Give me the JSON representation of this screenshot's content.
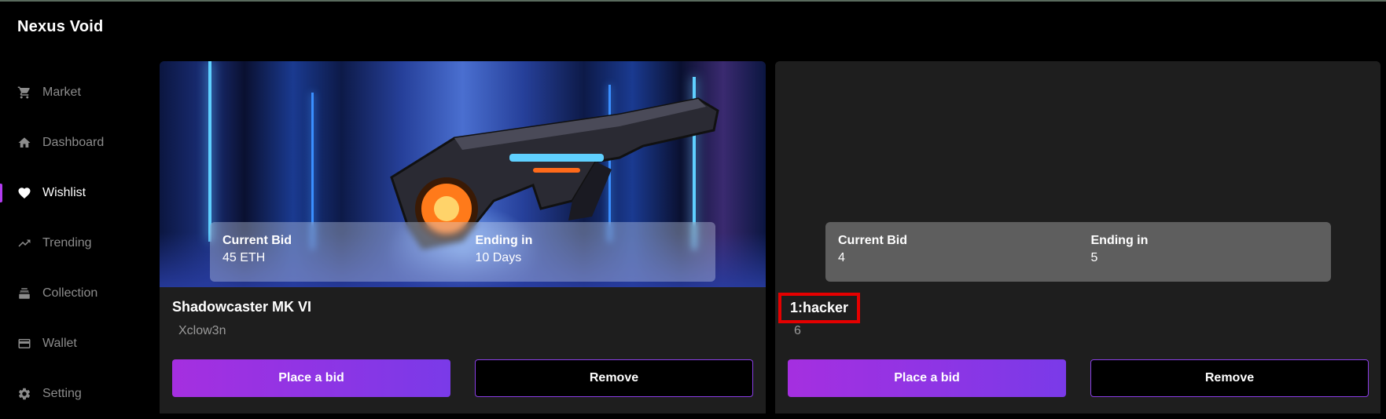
{
  "app": {
    "brand": "Nexus Void"
  },
  "sidebar": {
    "items": [
      {
        "label": "Market",
        "icon": "cart-icon",
        "active": false
      },
      {
        "label": "Dashboard",
        "icon": "home-icon",
        "active": false
      },
      {
        "label": "Wishlist",
        "icon": "heart-icon",
        "active": true
      },
      {
        "label": "Trending",
        "icon": "trending-up-icon",
        "active": false
      },
      {
        "label": "Collection",
        "icon": "stack-icon",
        "active": false
      },
      {
        "label": "Wallet",
        "icon": "card-icon",
        "active": false
      },
      {
        "label": "Setting",
        "icon": "gear-icon",
        "active": false
      }
    ]
  },
  "cards": [
    {
      "image": "cyberpunk-blaster-image",
      "current_bid_label": "Current Bid",
      "current_bid_value": "45 ETH",
      "ending_label": "Ending in",
      "ending_value": "10 Days",
      "title": "Shadowcaster MK VI",
      "owner": "Xclow3n",
      "bid_button": "Place a bid",
      "remove_button": "Remove"
    },
    {
      "image": "missing-image",
      "current_bid_label": "Current Bid",
      "current_bid_value": "4",
      "ending_label": "Ending in",
      "ending_value": "5",
      "title": "1:hacker",
      "owner": "6",
      "bid_button": "Place a bid",
      "remove_button": "Remove"
    }
  ],
  "colors": {
    "background": "#000000",
    "card": "#1e1e1e",
    "accent_gradient_start": "#a52fe0",
    "accent_gradient_end": "#7a3ae8",
    "highlight_box": "#e50000"
  }
}
